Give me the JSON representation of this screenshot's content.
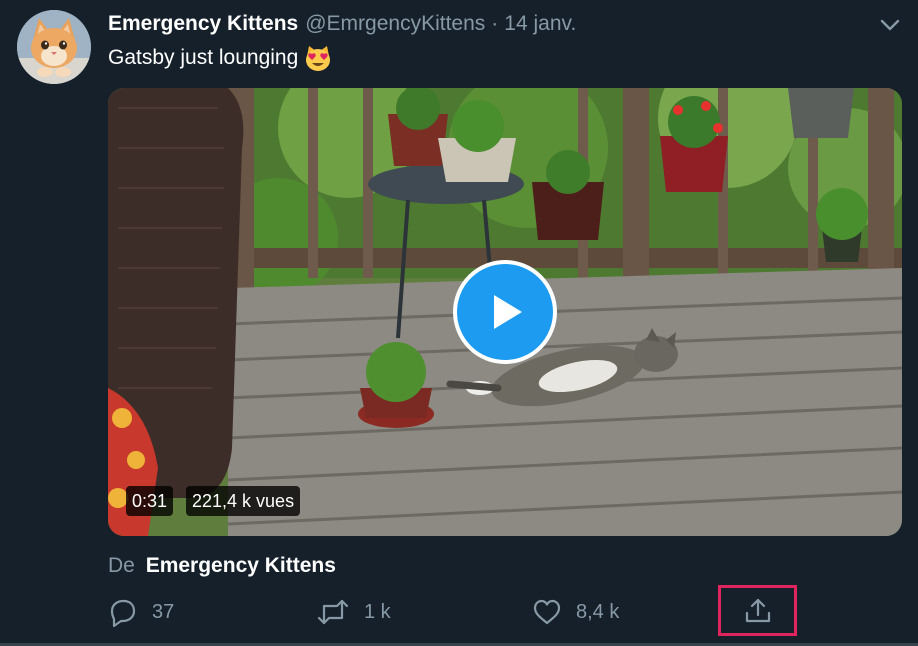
{
  "tweet": {
    "author": {
      "display_name": "Emergency Kittens",
      "handle": "@EmrgencyKittens",
      "avatar_icon": "kitten-avatar"
    },
    "separator": "·",
    "timestamp": "14 janv.",
    "text": "Gatsby just lounging",
    "emoji": "heart-eyes-cat-emoji",
    "media": {
      "type": "video",
      "duration": "0:31",
      "views": "221,4 k vues",
      "play_icon": "play-icon"
    },
    "source": {
      "prefix": "De",
      "name": "Emergency Kittens"
    },
    "actions": {
      "reply": {
        "icon": "reply-icon",
        "count": "37"
      },
      "retweet": {
        "icon": "retweet-icon",
        "count": "1 k"
      },
      "like": {
        "icon": "heart-icon",
        "count": "8,4 k"
      },
      "share": {
        "icon": "share-icon",
        "highlight_color": "#e0245e"
      }
    }
  },
  "colors": {
    "background": "#15202b",
    "secondary_text": "#8899a6",
    "play_button": "#1d9bf0",
    "highlight": "#e0245e"
  }
}
